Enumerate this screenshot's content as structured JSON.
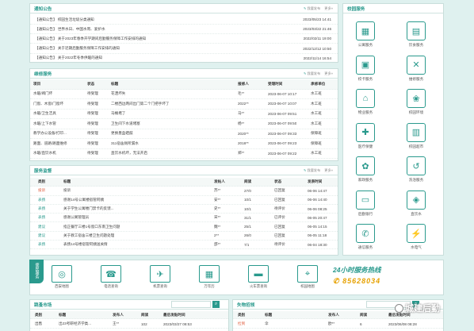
{
  "notice": {
    "title": "通知公告",
    "publish": "我要发布",
    "more": "更多»",
    "items": [
      {
        "text": "【通知公告】 校园生活垃圾分类通知",
        "date": "2023/05/23 14:41"
      },
      {
        "text": "【通知公告】 世界水日、中国水周、爱护水",
        "date": "2023/03/22 21:46"
      },
      {
        "text": "【通知公告】 关于2023年春季开学期间后勤服务保障工作安排的通知",
        "date": "2022/02/11 19:00"
      },
      {
        "text": "【通知公告】 关于近期后勤服务保障工作安排的通知",
        "date": "2022/12/12 10:50"
      },
      {
        "text": "【通知公告】 关于2022年冬季供暖的通知",
        "date": "2022/11/14 16:54"
      }
    ]
  },
  "repair": {
    "title": "维修服务",
    "publish": "我要发布",
    "more": "更多»",
    "headers": [
      "项目",
      "状态",
      "标题",
      "报修人",
      "受理时间",
      "承修单位"
    ],
    "rows": [
      [
        "水暖/阀门坏",
        "待受理",
        "花洒坏失",
        "毛**",
        "2023-06-07 10:17",
        "水工班"
      ],
      [
        "门窗、木窗/门窗坏",
        "待受理",
        "二楼西边两间出门第二个门把手坏了",
        "2022**",
        "2023-06-07 10:07",
        "木工班"
      ],
      [
        "水暖/卫生洁具",
        "待受理",
        "马桶堵了",
        "马**",
        "2023-06-07 09:51",
        "水工班"
      ],
      [
        "水暖/上下水管",
        "待受理",
        "卫生间下水道堵塞",
        "杨**",
        "2023-06-07 09:50",
        "水工班"
      ],
      [
        "教学办公设备/打印...",
        "待受理",
        "更换墨盒硒鼓",
        "2020**",
        "2023-06-07 09:33",
        "保障班"
      ],
      [
        "路面、道路/路面维修",
        "待受理",
        "311宿舍厕所漏水",
        "2018**",
        "2023-06-07 09:23",
        "保障班"
      ],
      [
        "水暖/直饮水机",
        "待受理",
        "直饮水机坏，无法开启",
        "郑**",
        "2023-06-07 09:22",
        "水工班"
      ]
    ]
  },
  "supervise": {
    "title": "服务监督",
    "publish": "我要发布",
    "more": "更多»",
    "headers": [
      "类别",
      "标题",
      "发帖人",
      "阅读",
      "状态",
      "发表时间"
    ],
    "rows": [
      [
        "投诉",
        "投诉",
        "苏**",
        "27/0",
        "已回复",
        "06-06 14:47"
      ],
      [
        "表扬",
        "感谢14号公寓楼宿管阿姨",
        "安**",
        "10/1",
        "已回复",
        "06-06 14:40"
      ],
      [
        "表扬",
        "关于学生公寓楼门禁卡的反馈...",
        "史**",
        "10/1",
        "待评价",
        "06-06 08:25"
      ],
      [
        "表扬",
        "感谢公寓管理员",
        "宋**",
        "31/1",
        "已评价",
        "06-05 20:47"
      ],
      [
        "建议",
        "指正餐厅三楼1号窗口东南卫生问题",
        "魏**",
        "25/1",
        "已回复",
        "06-05 14:15"
      ],
      [
        "建议",
        "关于教工宿舍三楼卫生问题处理",
        "2**",
        "26/0",
        "已回复",
        "06-05 11:18"
      ],
      [
        "表扬",
        "表扬14号楼宿管阿姨送关情",
        "邵**",
        "7/1",
        "待评价",
        "06-04 18:30"
      ]
    ]
  },
  "campus": {
    "title": "校园服务",
    "items": [
      {
        "label": "公寓服务",
        "icon": "▦"
      },
      {
        "label": "饮食服务",
        "icon": "▤"
      },
      {
        "label": "校卡服务",
        "icon": "▣"
      },
      {
        "label": "维修服务",
        "icon": "✕"
      },
      {
        "label": "物业服务",
        "icon": "⌂"
      },
      {
        "label": "校园环境",
        "icon": "❀"
      },
      {
        "label": "医疗保健",
        "icon": "✚"
      },
      {
        "label": "校园超市",
        "icon": "▥"
      },
      {
        "label": "家政服务",
        "icon": "✿"
      },
      {
        "label": "洗浴服务",
        "icon": "↺"
      },
      {
        "label": "后勤银行",
        "icon": "▭"
      },
      {
        "label": "直饮水",
        "icon": "◈"
      },
      {
        "label": "通信服务",
        "icon": "✆"
      },
      {
        "label": "水电气",
        "icon": "⚡"
      }
    ]
  },
  "quick": {
    "badge": "便民服务",
    "items": [
      {
        "label": "西安地图",
        "icon": "◎"
      },
      {
        "label": "电话查询",
        "icon": "☎"
      },
      {
        "label": "机票查询",
        "icon": "✈"
      },
      {
        "label": "万年历",
        "icon": "▦"
      },
      {
        "label": "火车票查询",
        "icon": "▬"
      },
      {
        "label": "校园地图",
        "icon": "⌖"
      }
    ],
    "hotline_title": "24小时服务热线",
    "hotline_number": "85628034"
  },
  "market": {
    "title": "跳蚤市场",
    "headers": [
      "类别",
      "标题",
      "发布人",
      "阅读",
      "最后发贴时间"
    ],
    "row": [
      "出售",
      "出23考研经济学类...",
      "王**",
      "102",
      "2023/03/27 08:53"
    ]
  },
  "lost": {
    "title": "失物招领",
    "headers": [
      "类别",
      "标题",
      "发布人",
      "阅读",
      "最后发贴时间"
    ],
    "row": [
      "捡到",
      "伞",
      "欧**",
      "6",
      "2023/06/08 08:28"
    ]
  },
  "watermark": "城建后勤"
}
